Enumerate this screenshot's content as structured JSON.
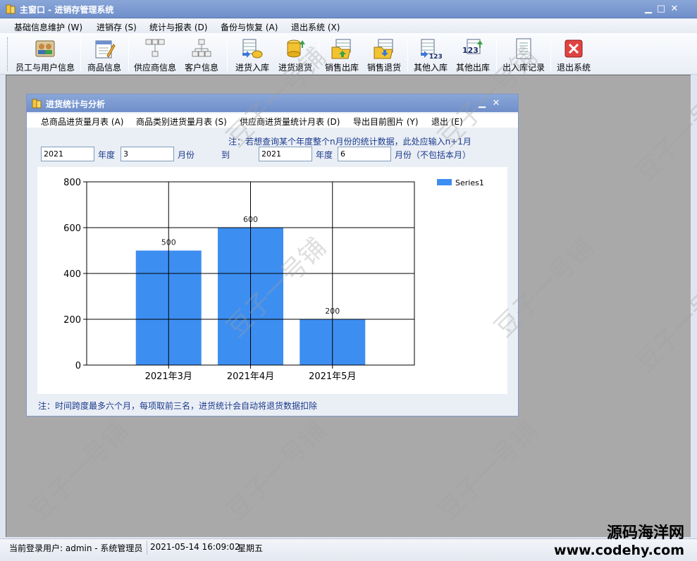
{
  "window": {
    "title": "主窗口 - 进销存管理系统"
  },
  "menu": [
    "基础信息维护 (W)",
    "进销存 (S)",
    "统计与报表 (D)",
    "备份与恢复 (A)",
    "退出系统 (X)"
  ],
  "toolbar": [
    "员工与用户信息",
    "商品信息",
    "供应商信息",
    "客户信息",
    "进货入库",
    "进货退货",
    "销售出库",
    "销售退货",
    "其他入库",
    "其他出库",
    "出入库记录",
    "退出系统"
  ],
  "child": {
    "title": "进货统计与分析",
    "menu": [
      "总商品进货量月表 (A)",
      "商品类别进货量月表 (S)",
      "供应商进货量统计月表 (D)",
      "导出目前图片 (Y)",
      "退出 (E)"
    ],
    "note_top": "注：若想查询某个年度整个n月份的统计数据，此处应输入n+1月",
    "from_year": "2021",
    "year_label": "年度",
    "from_month": "3",
    "month_label": "月份",
    "to_label": "到",
    "to_year": "2021",
    "to_month": "6",
    "month_exclusive_label": "月份（不包括本月）",
    "note_bottom": "注：时间跨度最多六个月，每项取前三名，进货统计会自动将退货数据扣除"
  },
  "chart_data": {
    "type": "bar",
    "categories": [
      "2021年3月",
      "2021年4月",
      "2021年5月"
    ],
    "series": [
      {
        "name": "Series1",
        "values": [
          500,
          600,
          200
        ]
      }
    ],
    "ylim": [
      0,
      800
    ],
    "yticks": [
      "0",
      "200",
      "400",
      "600",
      "800"
    ],
    "grid": true,
    "legend": "top-right",
    "color": "#3d8ef1"
  },
  "status": {
    "user": "当前登录用户: admin - 系统管理员",
    "datetime": "2021-05-14 16:09:02",
    "weekday": "星期五"
  },
  "watermark": "豆子一号铺",
  "brand": {
    "cn": "源码海洋网",
    "url": "www.codehy.com"
  }
}
